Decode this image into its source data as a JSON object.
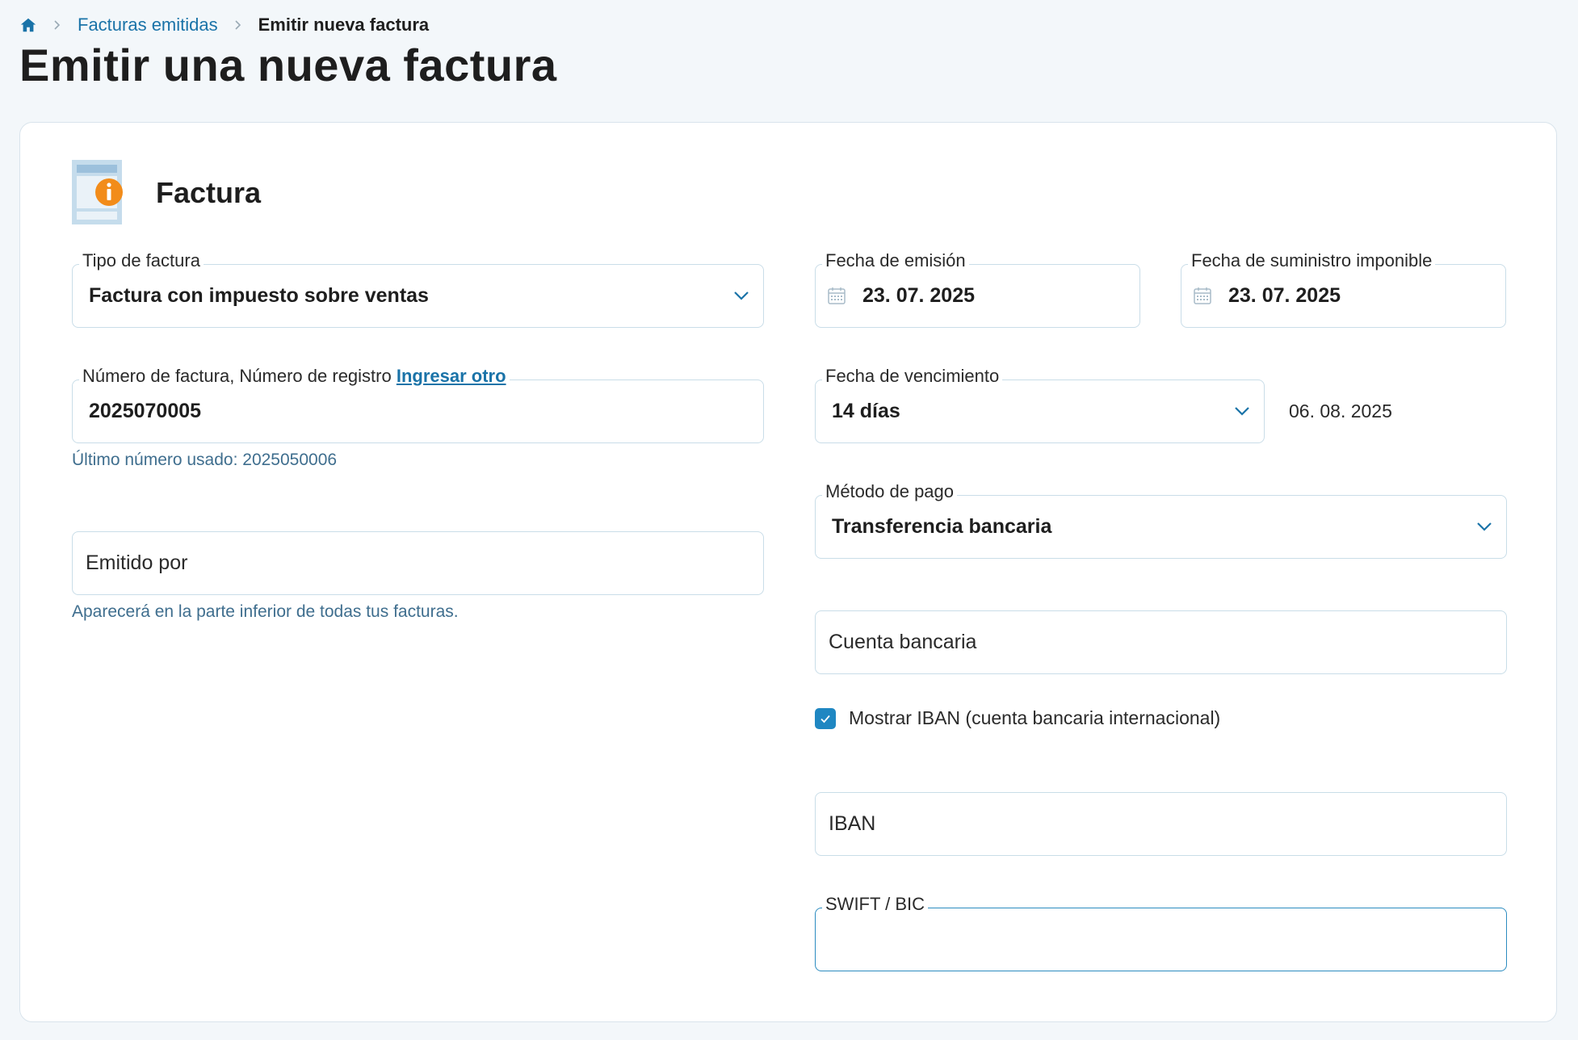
{
  "breadcrumb": {
    "home_icon": "home-icon",
    "parent": "Facturas emitidas",
    "current": "Emitir nueva factura"
  },
  "page_title": "Emitir una nueva factura",
  "colors": {
    "accent": "#1a73a8",
    "checkbox": "#1f87c2",
    "info_badge": "#f28c1a",
    "hint": "#3f6e8e"
  },
  "section": {
    "icon": "invoice-info-icon",
    "title": "Factura"
  },
  "fields": {
    "invoice_type": {
      "label": "Tipo de factura",
      "value": "Factura con impuesto sobre ventas"
    },
    "invoice_number": {
      "label": "Número de factura, Número de registro",
      "link": "Ingresar otro",
      "value": "2025070005",
      "hint": "Último número usado: 2025050006"
    },
    "issued_by": {
      "placeholder": "Emitido por",
      "hint": "Aparecerá en la parte inferior de todas tus facturas."
    },
    "issue_date": {
      "label": "Fecha de emisión",
      "value": "23. 07. 2025"
    },
    "supply_date": {
      "label": "Fecha de suministro imponible",
      "value": "23. 07. 2025"
    },
    "due": {
      "label": "Fecha de vencimiento",
      "value": "14 días",
      "computed_date": "06. 08. 2025"
    },
    "payment_method": {
      "label": "Método de pago",
      "value": "Transferencia bancaria"
    },
    "bank_account": {
      "placeholder": "Cuenta bancaria"
    },
    "show_iban": {
      "label": "Mostrar IBAN (cuenta bancaria internacional)",
      "checked": true
    },
    "iban": {
      "placeholder": "IBAN"
    },
    "swift": {
      "label": "SWIFT / BIC",
      "value": ""
    }
  }
}
